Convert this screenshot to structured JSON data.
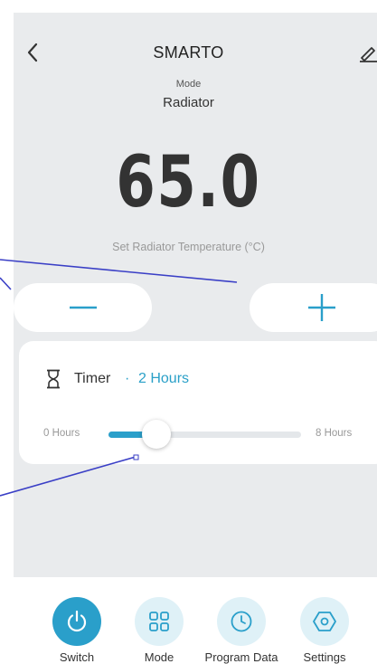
{
  "header": {
    "title": "SMARTO",
    "back_icon": "chevron-left-icon",
    "edit_icon": "pencil-icon"
  },
  "mode": {
    "caption": "Mode",
    "value": "Radiator"
  },
  "temperature": {
    "value": "65.0",
    "caption": "Set Radiator Temperature (°C)",
    "decrease_icon": "minus-icon",
    "increase_icon": "plus-icon"
  },
  "timer": {
    "icon": "hourglass-icon",
    "label": "Timer",
    "separator": "·",
    "value": "2 Hours",
    "slider": {
      "min_label": "0 Hours",
      "max_label": "8 Hours",
      "min": 0,
      "max": 8,
      "current": 2
    }
  },
  "nav": [
    {
      "label": "Switch",
      "icon": "power-icon",
      "active": true
    },
    {
      "label": "Mode",
      "icon": "grid-icon",
      "active": false
    },
    {
      "label": "Program Data",
      "icon": "clock-icon",
      "active": false
    },
    {
      "label": "Settings",
      "icon": "gear-hexagon-icon",
      "active": false
    }
  ],
  "colors": {
    "accent": "#2a9fca",
    "accent_light": "#dff1f7",
    "panel_bg": "#e9ebed",
    "annotation_line": "#3a3fc6"
  }
}
